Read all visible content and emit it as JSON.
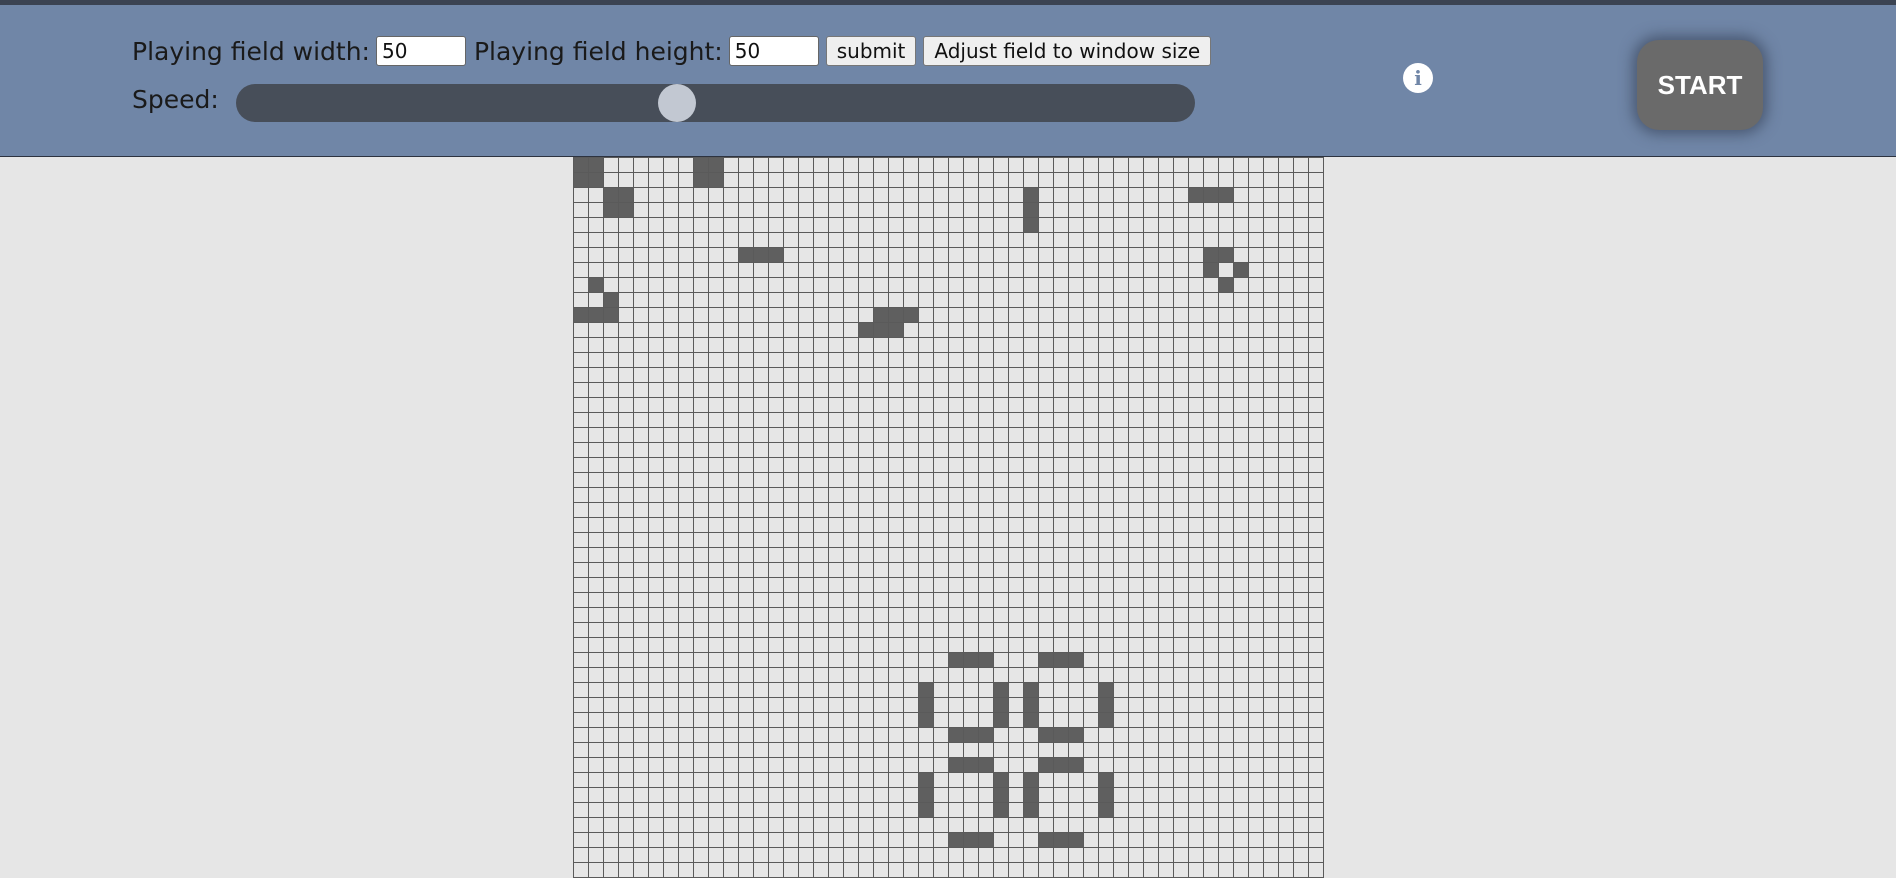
{
  "controls": {
    "width_label": "Playing field width:",
    "width_value": "50",
    "height_label": "Playing field height:",
    "height_value": "50",
    "submit_label": "submit",
    "adjust_label": "Adjust field to window size",
    "speed_label": "Speed:",
    "speed_fraction": 0.46,
    "info_icon": "info-icon",
    "info_glyph": "i",
    "start_label": "START"
  },
  "colors": {
    "header": "#7086a7",
    "live_cell": "#5f5f5f",
    "dead_cell": "#e6e6e6",
    "grid_line": "#5a5a5a",
    "slider_track": "#474e59",
    "start_button": "#6a6a6a"
  },
  "field": {
    "columns": 50,
    "visible_rows": 48,
    "live_cells": [
      [
        0,
        0
      ],
      [
        1,
        0
      ],
      [
        0,
        1
      ],
      [
        1,
        1
      ],
      [
        8,
        0
      ],
      [
        9,
        0
      ],
      [
        8,
        1
      ],
      [
        9,
        1
      ],
      [
        2,
        2
      ],
      [
        3,
        2
      ],
      [
        2,
        3
      ],
      [
        3,
        3
      ],
      [
        30,
        2
      ],
      [
        30,
        3
      ],
      [
        30,
        4
      ],
      [
        41,
        2
      ],
      [
        42,
        2
      ],
      [
        43,
        2
      ],
      [
        11,
        6
      ],
      [
        12,
        6
      ],
      [
        13,
        6
      ],
      [
        42,
        6
      ],
      [
        43,
        6
      ],
      [
        42,
        7
      ],
      [
        44,
        7
      ],
      [
        43,
        8
      ],
      [
        1,
        8
      ],
      [
        2,
        9
      ],
      [
        0,
        10
      ],
      [
        1,
        10
      ],
      [
        2,
        10
      ],
      [
        20,
        10
      ],
      [
        21,
        10
      ],
      [
        22,
        10
      ],
      [
        19,
        11
      ],
      [
        20,
        11
      ],
      [
        21,
        11
      ],
      [
        25,
        33
      ],
      [
        26,
        33
      ],
      [
        27,
        33
      ],
      [
        31,
        33
      ],
      [
        32,
        33
      ],
      [
        33,
        33
      ],
      [
        23,
        35
      ],
      [
        28,
        35
      ],
      [
        30,
        35
      ],
      [
        35,
        35
      ],
      [
        23,
        36
      ],
      [
        28,
        36
      ],
      [
        30,
        36
      ],
      [
        35,
        36
      ],
      [
        23,
        37
      ],
      [
        28,
        37
      ],
      [
        30,
        37
      ],
      [
        35,
        37
      ],
      [
        25,
        38
      ],
      [
        26,
        38
      ],
      [
        27,
        38
      ],
      [
        31,
        38
      ],
      [
        32,
        38
      ],
      [
        33,
        38
      ],
      [
        25,
        40
      ],
      [
        26,
        40
      ],
      [
        27,
        40
      ],
      [
        31,
        40
      ],
      [
        32,
        40
      ],
      [
        33,
        40
      ],
      [
        23,
        41
      ],
      [
        28,
        41
      ],
      [
        30,
        41
      ],
      [
        35,
        41
      ],
      [
        23,
        42
      ],
      [
        28,
        42
      ],
      [
        30,
        42
      ],
      [
        35,
        42
      ],
      [
        23,
        43
      ],
      [
        28,
        43
      ],
      [
        30,
        43
      ],
      [
        35,
        43
      ],
      [
        25,
        45
      ],
      [
        26,
        45
      ],
      [
        27,
        45
      ],
      [
        31,
        45
      ],
      [
        32,
        45
      ],
      [
        33,
        45
      ]
    ]
  }
}
